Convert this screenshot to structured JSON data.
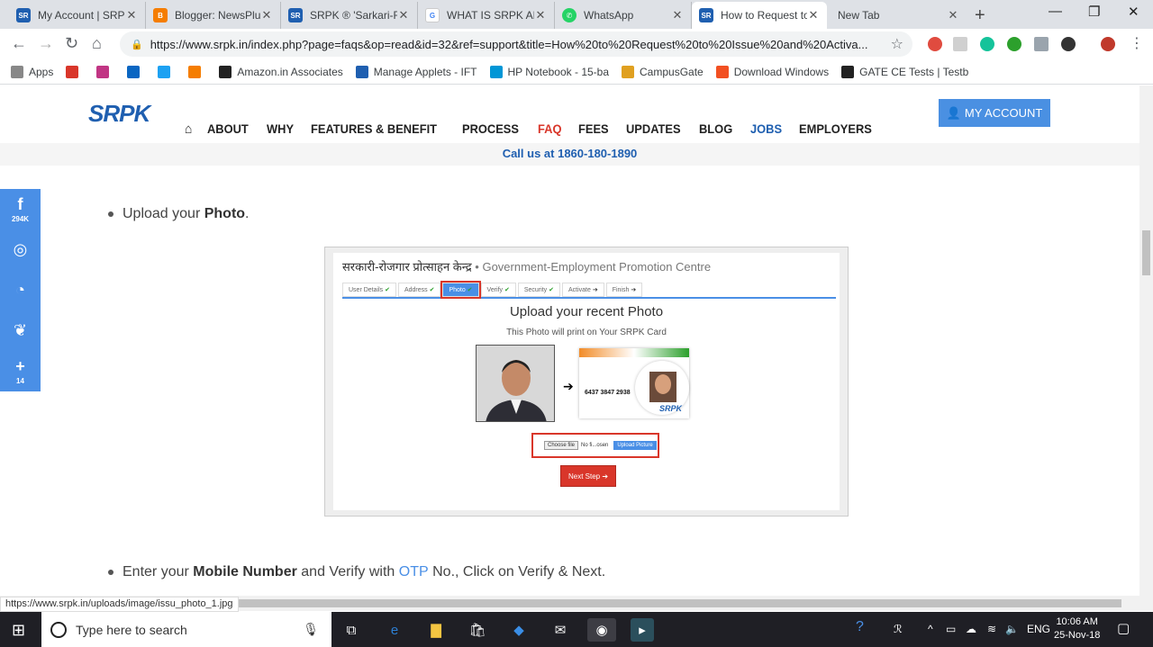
{
  "browser": {
    "tabs": [
      {
        "title": "My Account | SRPK",
        "icon": "srpk-icon",
        "color": "#1f5fb0"
      },
      {
        "title": "Blogger: NewsPlus",
        "icon": "blogger-icon",
        "color": "#f57d00"
      },
      {
        "title": "SRPK ® 'Sarkari-R",
        "icon": "srpk-icon",
        "color": "#1f5fb0"
      },
      {
        "title": "WHAT IS SRPK AN",
        "icon": "google-icon",
        "color": "#4285f4"
      },
      {
        "title": "WhatsApp",
        "icon": "whatsapp-icon",
        "color": "#25d366"
      },
      {
        "title": "How to Request to",
        "icon": "srpk-icon",
        "color": "#1f5fb0"
      },
      {
        "title": "New Tab",
        "icon": "",
        "color": ""
      }
    ],
    "url": "https://www.srpk.in/index.php?page=faqs&op=read&id=32&ref=support&title=How%20to%20Request%20to%20Issue%20and%20Activa...",
    "bookmarks": [
      {
        "label": "Apps",
        "icon": "apps-icon",
        "color": "#888"
      },
      {
        "label": "",
        "icon": "wordpress-icon",
        "color": "#d9362a"
      },
      {
        "label": "",
        "icon": "instagram-icon",
        "color": "#c13584"
      },
      {
        "label": "",
        "icon": "linkedin-icon",
        "color": "#0a66c2"
      },
      {
        "label": "",
        "icon": "twitter-icon",
        "color": "#1da1f2"
      },
      {
        "label": "",
        "icon": "blogger-icon",
        "color": "#f57d00"
      },
      {
        "label": "Amazon.in Associates",
        "icon": "amazon-icon",
        "color": "#222"
      },
      {
        "label": "Manage Applets - IFT",
        "icon": "ifttt-icon",
        "color": "#1f5fb0"
      },
      {
        "label": "HP Notebook - 15-ba",
        "icon": "hp-icon",
        "color": "#0096d6"
      },
      {
        "label": "CampusGate",
        "icon": "campusgate-icon",
        "color": "#e0a020"
      },
      {
        "label": "Download Windows",
        "icon": "windows-icon",
        "color": "#f25022"
      },
      {
        "label": "GATE CE Tests | Testb",
        "icon": "testbook-icon",
        "color": "#222"
      }
    ],
    "status_url": "https://www.srpk.in/uploads/image/issu_photo_1.jpg"
  },
  "site": {
    "logo": "SRPK",
    "nav": [
      "ABOUT",
      "WHY",
      "FEATURES & BENEFIT",
      "PROCESS",
      "FAQ",
      "FEES",
      "UPDATES",
      "BLOG",
      "JOBS",
      "EMPLOYERS"
    ],
    "active_nav": "FAQ",
    "my_account": "MY ACCOUNT",
    "call": "Call us at 1860-180-1890"
  },
  "share": [
    {
      "icon": "facebook-icon",
      "glyph": "f",
      "count": "294K"
    },
    {
      "icon": "whatsapp-icon",
      "glyph": "◎",
      "count": ""
    },
    {
      "icon": "messenger-icon",
      "glyph": "◔",
      "count": ""
    },
    {
      "icon": "twitter-icon",
      "glyph": "❦",
      "count": ""
    },
    {
      "icon": "plus-icon",
      "glyph": "+",
      "count": "14"
    }
  ],
  "content": {
    "step1_pre": "Upload your ",
    "step1_bold": "Photo",
    "step1_post": ".",
    "step2_a": "Enter your ",
    "step2_b": "Mobile Number",
    "step2_c": " and Verify with ",
    "step2_d": "OTP",
    "step2_e": " No., Click on Verify & Next."
  },
  "figure": {
    "title_dev": "सरकारी-रोजगार प्रोत्साहन केन्द्र",
    "title_en": " • Government-Employment Promotion Centre",
    "steps": [
      "User Details",
      "Address",
      "Photo",
      "Verify",
      "Security",
      "Activate",
      "Finish"
    ],
    "heading": "Upload your recent Photo",
    "sub": "This Photo will print on Your SRPK Card",
    "card_number": "6437 3847 2938",
    "card_brand": "SRPK",
    "choose_file": "Choose file",
    "no_file": "No fi...osen",
    "upload_btn": "Upload Picture",
    "next_btn": "Next Step ➔"
  },
  "taskbar": {
    "search_placeholder": "Type here to search",
    "lang": "ENG",
    "time": "10:06 AM",
    "date": "25-Nov-18"
  }
}
